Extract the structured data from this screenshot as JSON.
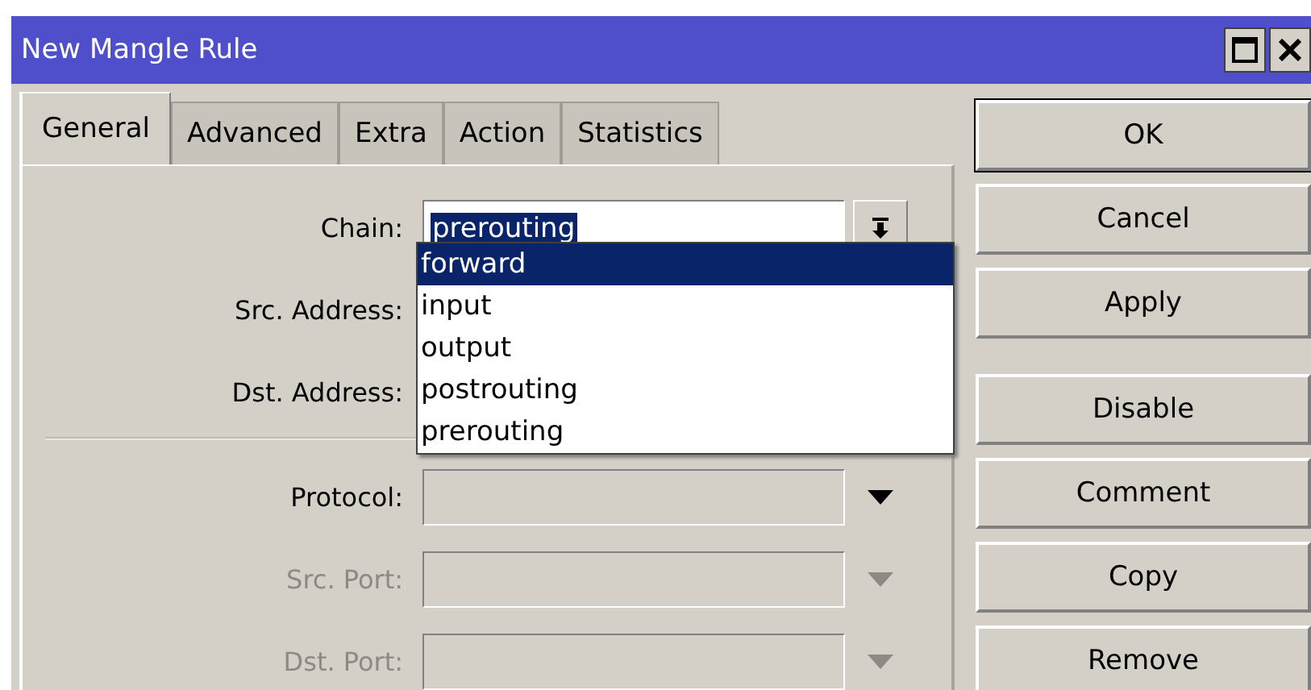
{
  "window": {
    "title": "New Mangle Rule"
  },
  "tabs": [
    {
      "label": "General",
      "selected": true
    },
    {
      "label": "Advanced",
      "selected": false
    },
    {
      "label": "Extra",
      "selected": false
    },
    {
      "label": "Action",
      "selected": false
    },
    {
      "label": "Statistics",
      "selected": false
    }
  ],
  "fields": [
    {
      "kind": "chain",
      "label": "Chain:",
      "value": "prerouting"
    },
    {
      "kind": "covered",
      "label": "Src. Address:"
    },
    {
      "kind": "covered",
      "label": "Dst. Address:"
    },
    {
      "kind": "separator"
    },
    {
      "kind": "combo",
      "label": "Protocol:",
      "disabled": false
    },
    {
      "kind": "combo",
      "label": "Src. Port:",
      "disabled": true
    },
    {
      "kind": "combo",
      "label": "Dst. Port:",
      "disabled": true
    }
  ],
  "chain_options": [
    {
      "label": "forward",
      "selected": true
    },
    {
      "label": "input",
      "selected": false
    },
    {
      "label": "output",
      "selected": false
    },
    {
      "label": "postrouting",
      "selected": false
    },
    {
      "label": "prerouting",
      "selected": false
    }
  ],
  "buttons": [
    {
      "label": "OK",
      "default": true
    },
    {
      "label": "Cancel",
      "default": false
    },
    {
      "label": "Apply",
      "default": false
    },
    {
      "label": "Disable",
      "default": false
    },
    {
      "label": "Comment",
      "default": false
    },
    {
      "label": "Copy",
      "default": false
    },
    {
      "label": "Remove",
      "default": false
    }
  ]
}
